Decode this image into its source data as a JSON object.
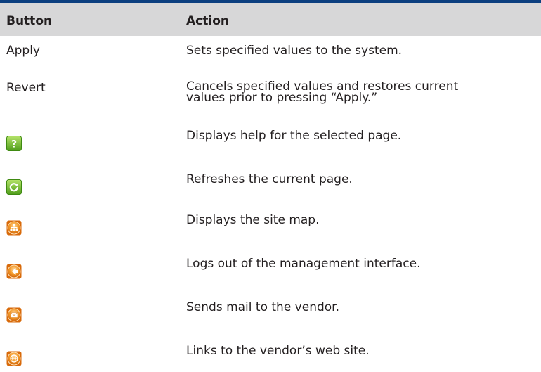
{
  "header": {
    "button_label": "Button",
    "action_label": "Action"
  },
  "rows": [
    {
      "button": "Apply",
      "action": "Sets specified values to the system."
    },
    {
      "button": "Revert",
      "action_line1": "Cancels specified values and restores current",
      "action_line2": "values prior to pressing “Apply.”"
    },
    {
      "icon": "help-icon",
      "icon_color": "#6fbf2a",
      "action": "Displays help for the selected page."
    },
    {
      "icon": "refresh-icon",
      "icon_color": "#6fbf2a",
      "action": "Refreshes the current page."
    },
    {
      "icon": "site-map-icon",
      "icon_color": "#e8780f",
      "action": "Displays the site map."
    },
    {
      "icon": "logout-icon",
      "icon_color": "#e8780f",
      "action": "Logs out of the management interface."
    },
    {
      "icon": "mail-icon",
      "icon_color": "#e8780f",
      "action": "Sends mail to the vendor."
    },
    {
      "icon": "web-site-icon",
      "icon_color": "#e8780f",
      "action": "Links to the vendor’s web site."
    }
  ],
  "colors": {
    "top_rule": "#0b3f7f",
    "header_background": "#d7d7d8"
  }
}
